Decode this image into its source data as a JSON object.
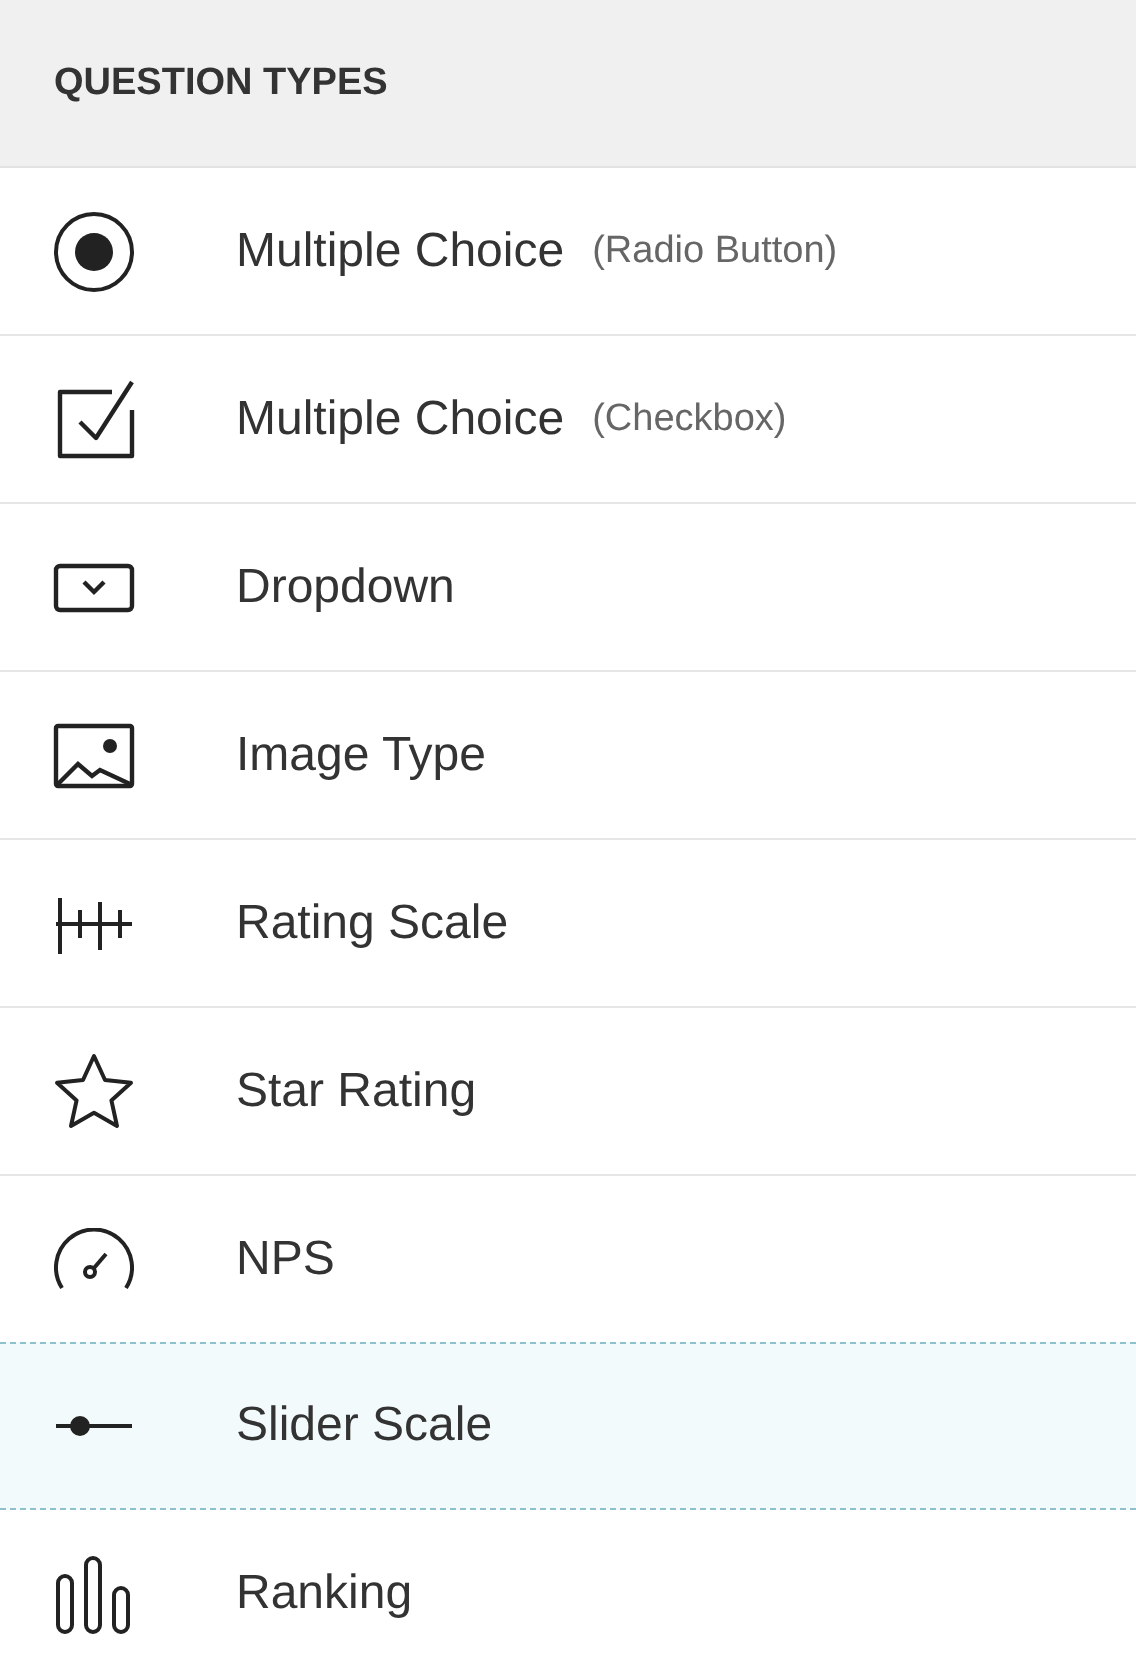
{
  "header": {
    "title": "QUESTION TYPES"
  },
  "items": [
    {
      "kind": "radio",
      "label": "Multiple Choice",
      "note": "(Radio Button)",
      "selected": false
    },
    {
      "kind": "checkbox",
      "label": "Multiple Choice",
      "note": "(Checkbox)",
      "selected": false
    },
    {
      "kind": "dropdown",
      "label": "Dropdown",
      "selected": false
    },
    {
      "kind": "image",
      "label": "Image Type",
      "selected": false
    },
    {
      "kind": "rating",
      "label": "Rating Scale",
      "selected": false
    },
    {
      "kind": "star",
      "label": "Star Rating",
      "selected": false
    },
    {
      "kind": "nps",
      "label": "NPS",
      "selected": false
    },
    {
      "kind": "slider",
      "label": "Slider Scale",
      "selected": true
    },
    {
      "kind": "ranking",
      "label": "Ranking",
      "selected": false
    }
  ]
}
